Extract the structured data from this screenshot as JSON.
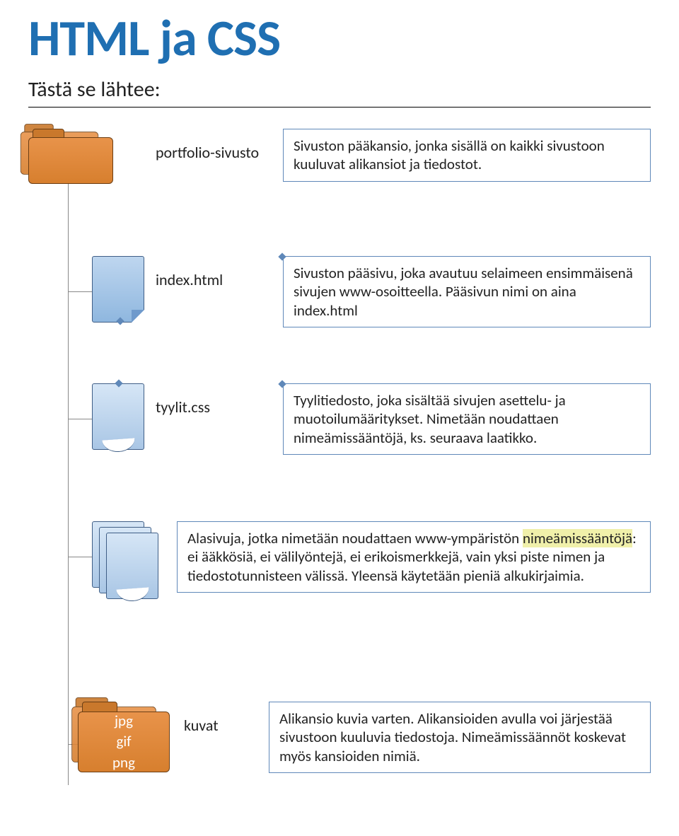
{
  "title": "HTML ja CSS",
  "subtitle": "Tästä se lähtee:",
  "rows": [
    {
      "label": "portfolio-sivusto",
      "desc": "Sivuston pääkansio, jonka sisällä on kaikki sivustoon kuuluvat alikansiot ja tiedostot."
    },
    {
      "label": "index.html",
      "desc": "Sivuston pääsivu, joka avautuu selaimeen ensimmäisenä sivujen www-osoitteella. Pääsivun nimi on aina index.html"
    },
    {
      "label": "tyylit.css",
      "desc": "Tyylitiedosto, joka sisältää sivujen asettelu- ja muotoilumääritykset. Nimetään noudattaen nimeämissääntöjä, ks. seuraava laatikko."
    },
    {
      "desc_pre": "Alasivuja, jotka nimetään noudattaen www-ympäristön ",
      "desc_hl": "nimeämissääntöjä",
      "desc_post": ": ei ääkkösiä, ei välilyöntejä, ei erikoismerkkejä, vain yksi piste nimen ja tiedostotunnisteen välissä. Yleensä käytetään pieniä alkukirjaimia."
    },
    {
      "label": "kuvat",
      "folder_lines": [
        "jpg",
        "gif",
        "png"
      ],
      "desc": "Alikansio kuvia varten. Alikansioiden avulla voi järjestää sivustoon kuuluvia tiedostoja. Nimeämissäännöt koskevat myös kansioiden nimiä."
    }
  ]
}
